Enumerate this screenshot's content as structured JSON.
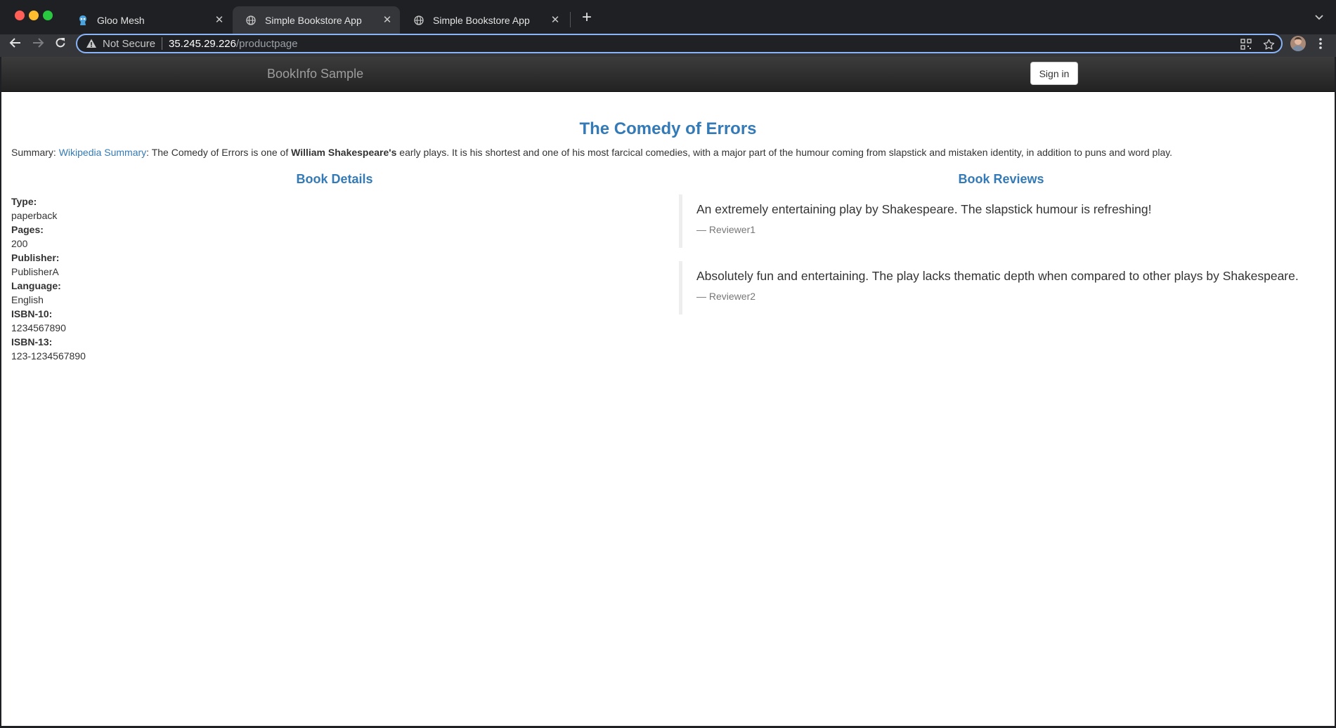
{
  "browser": {
    "tabs": [
      {
        "title": "Gloo Mesh",
        "active": false,
        "icon": "gloo-mesh-favicon"
      },
      {
        "title": "Simple Bookstore App",
        "active": true,
        "icon": "globe-icon"
      },
      {
        "title": "Simple Bookstore App",
        "active": false,
        "icon": "globe-icon"
      }
    ],
    "address": {
      "security_label": "Not Secure",
      "host": "35.245.29.226",
      "path": "/productpage"
    }
  },
  "app": {
    "brand": "BookInfo Sample",
    "signin_label": "Sign in"
  },
  "book": {
    "title": "The Comedy of Errors",
    "summary": {
      "label": "Summary:",
      "link_text": "Wikipedia Summary",
      "text_before": ": The Comedy of Errors is one of ",
      "bold": "William Shakespeare's",
      "text_after": " early plays. It is his shortest and one of his most farcical comedies, with a major part of the humour coming from slapstick and mistaken identity, in addition to puns and word play."
    }
  },
  "details": {
    "heading": "Book Details",
    "fields": [
      {
        "label": "Type:",
        "value": "paperback"
      },
      {
        "label": "Pages:",
        "value": "200"
      },
      {
        "label": "Publisher:",
        "value": "PublisherA"
      },
      {
        "label": "Language:",
        "value": "English"
      },
      {
        "label": "ISBN-10:",
        "value": "1234567890"
      },
      {
        "label": "ISBN-13:",
        "value": "123-1234567890"
      }
    ]
  },
  "reviews": {
    "heading": "Book Reviews",
    "items": [
      {
        "text": "An extremely entertaining play by Shakespeare. The slapstick humour is refreshing!",
        "author": "— Reviewer1"
      },
      {
        "text": "Absolutely fun and entertaining. The play lacks thematic depth when compared to other plays by Shakespeare.",
        "author": "— Reviewer2"
      }
    ]
  },
  "colors": {
    "link": "#337ab7",
    "nav_dark": "#222222",
    "omnibox_focus": "#8ab4f8"
  }
}
